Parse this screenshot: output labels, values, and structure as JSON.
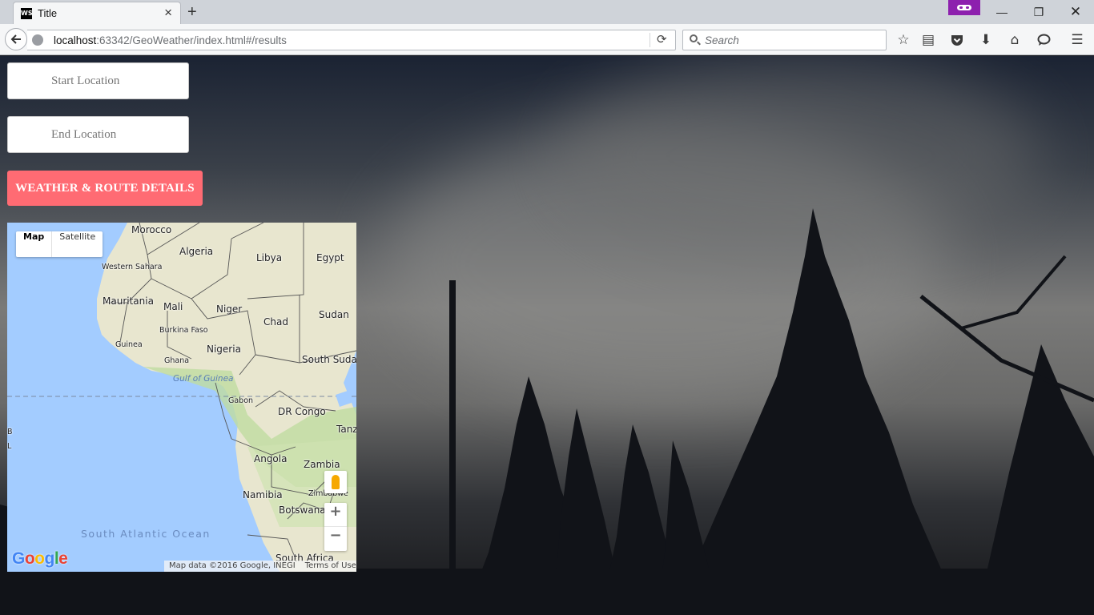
{
  "browser": {
    "tab": {
      "title": "Title",
      "favicon": "WS"
    },
    "url": {
      "host": "localhost",
      "rest": ":63342/GeoWeather/index.html#/results"
    },
    "search_placeholder": "Search",
    "icons": [
      "back-arrow-icon",
      "globe-icon",
      "reload-icon",
      "search-icon",
      "star-icon",
      "reading-list-icon",
      "pocket-icon",
      "download-icon",
      "home-icon",
      "chat-icon",
      "menu-icon"
    ]
  },
  "form": {
    "start_placeholder": "Start Location",
    "end_placeholder": "End Location",
    "submit_label": "WEATHER & ROUTE DETAILS",
    "accent_color": "#ff6b73"
  },
  "map": {
    "type_buttons": [
      "Map",
      "Satellite"
    ],
    "active_type": "Map",
    "countries": [
      "Morocco",
      "Algeria",
      "Libya",
      "Egypt",
      "Western Sahara",
      "Mauritania",
      "Mali",
      "Niger",
      "Chad",
      "Sudan",
      "Burkina Faso",
      "Guinea",
      "Nigeria",
      "Ghana",
      "South Sudan",
      "Gabon",
      "DR Congo",
      "Tanz",
      "Angola",
      "Zambia",
      "Zimbabwe",
      "Namibia",
      "Botswana",
      "South Africa"
    ],
    "water": {
      "gulf": "Gulf of Guinea",
      "ocean": "South Atlantic Ocean"
    },
    "zoom_in": "+",
    "zoom_out": "−",
    "attribution": "Map data ©2016 Google, INEGI",
    "terms": "Terms of Use",
    "logo": "Google",
    "edge_letters": [
      "B",
      "L"
    ]
  }
}
